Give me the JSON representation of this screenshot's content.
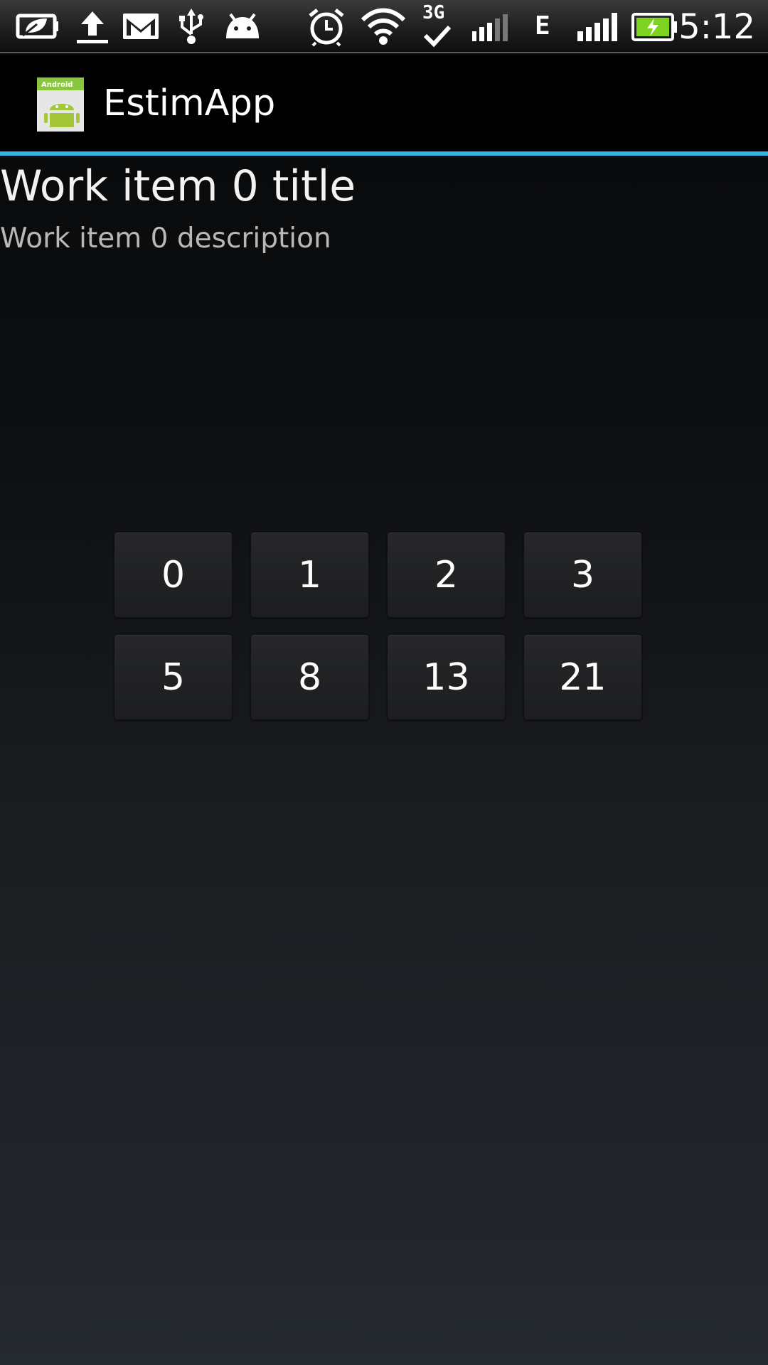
{
  "status_bar": {
    "time": "5:12",
    "network_3g_label": "3G",
    "network_e_label": "E",
    "left_icons": [
      "battery-saver-icon",
      "upload-icon",
      "gmail-icon",
      "usb-icon",
      "android-debug-icon"
    ],
    "right_icons": [
      "alarm-icon",
      "wifi-icon",
      "3g-sync-icon",
      "signal-icon",
      "edge-icon",
      "signal-strength-icon",
      "battery-charging-icon"
    ],
    "battery_color": "#7ed321"
  },
  "action_bar": {
    "title": "EstimApp",
    "app_icon": "android-app-icon",
    "app_icon_label": "Android",
    "divider_color": "#33b5e5"
  },
  "work_item": {
    "title": "Work item 0 title",
    "description": "Work item 0 description"
  },
  "estimates": {
    "row1": [
      "0",
      "1",
      "2",
      "3"
    ],
    "row2": [
      "5",
      "8",
      "13",
      "21"
    ]
  }
}
